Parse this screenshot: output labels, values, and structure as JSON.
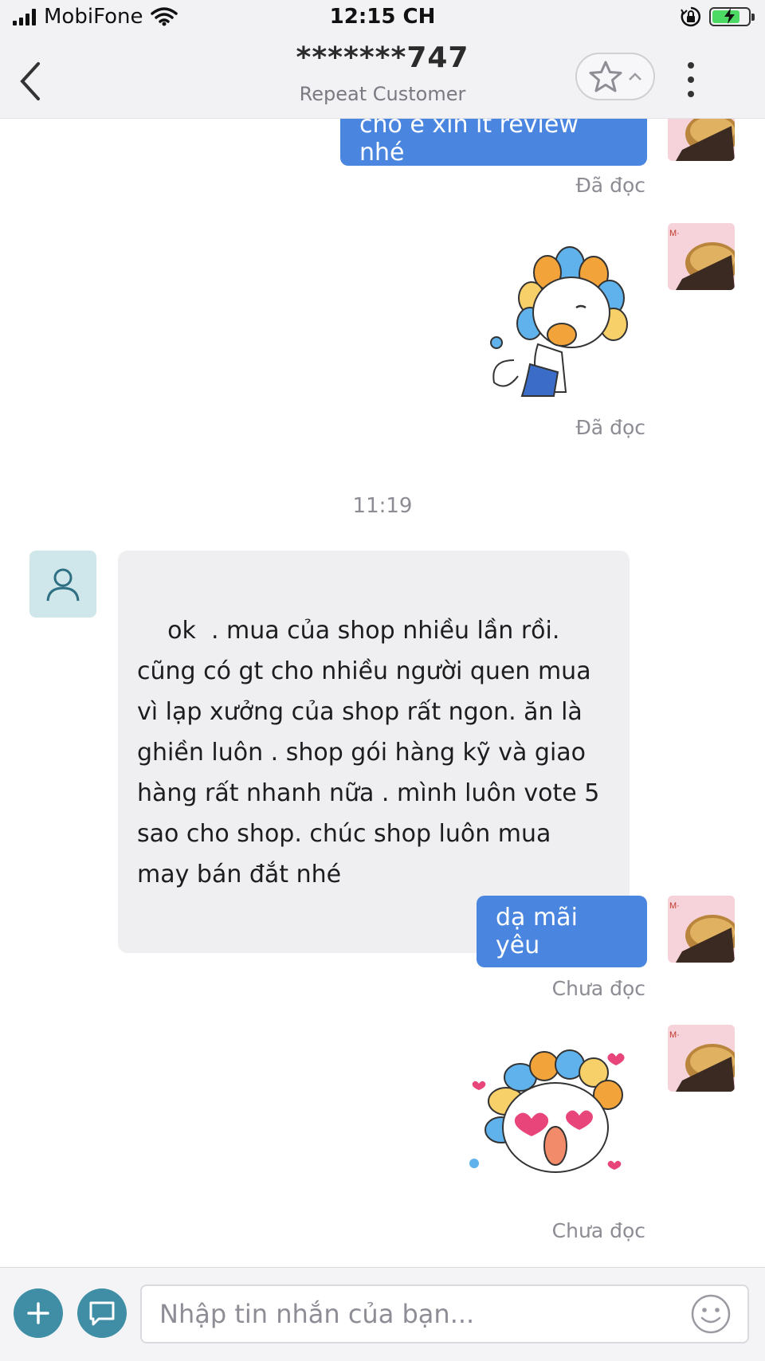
{
  "status_bar": {
    "carrier": "MobiFone",
    "time": "12:15 CH"
  },
  "header": {
    "title": "*******747",
    "subtitle": "Repeat Customer",
    "back_icon": "chevron-left-icon",
    "favorite_icon": "star-outline-icon",
    "more_icon": "more-vertical-icon"
  },
  "messages": {
    "out_1": {
      "text": "cho e xin ít review nhé",
      "status": "Đã đọc"
    },
    "sticker_1": {
      "status": "Đã đọc"
    },
    "time_divider": "11:19",
    "in_1": {
      "text": "ok  . mua của shop nhiều lần rồi. cũng có gt cho nhiều người quen mua vì lạp xưởng của shop rất ngon. ăn là ghiền luôn . shop gói hàng kỹ và giao hàng rất nhanh nữa . mình luôn vote 5 sao cho shop. chúc shop luôn mua may bán đắt nhé"
    },
    "out_2": {
      "text": "dạ mãi yêu",
      "status": "Chưa đọc"
    },
    "sticker_2": {
      "status": "Chưa đọc"
    }
  },
  "input_bar": {
    "placeholder": "Nhập tin nhắn của bạn..."
  },
  "colors": {
    "outgoing_bubble": "#4a86e0",
    "incoming_bubble": "#efeff1",
    "action_button": "#3f8ea6",
    "header_bg": "#f2f2f5"
  }
}
